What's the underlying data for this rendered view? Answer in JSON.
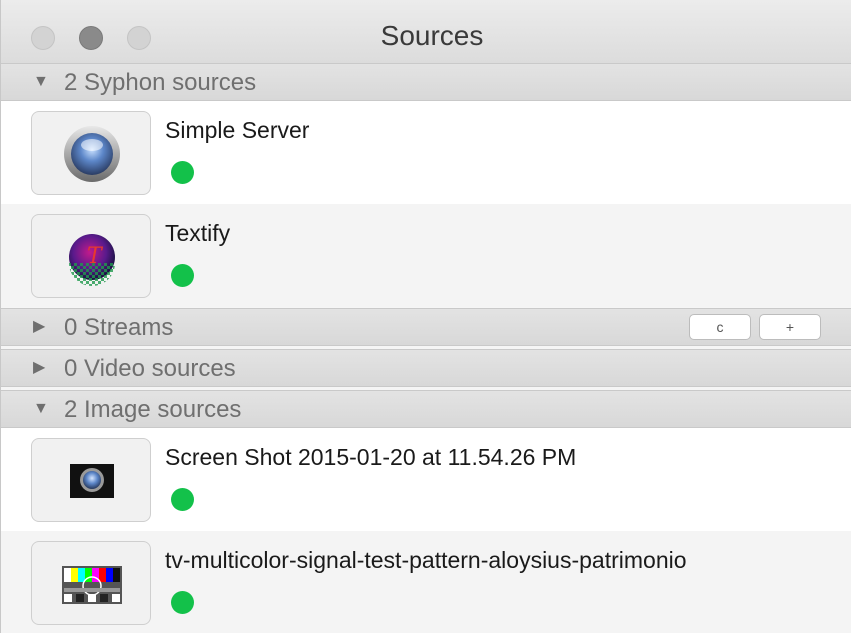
{
  "window": {
    "title": "Sources"
  },
  "sections": {
    "syphon": {
      "label": "2 Syphon sources",
      "expanded": true
    },
    "streams": {
      "label": "0 Streams",
      "expanded": false,
      "buttons": [
        "c",
        "+"
      ]
    },
    "video": {
      "label": "0 Video sources",
      "expanded": false
    },
    "image": {
      "label": "2 Image sources",
      "expanded": true
    }
  },
  "syphon_items": [
    {
      "name": "Simple Server",
      "status": "active",
      "status_color": "#13c14a",
      "icon": "simple-server-icon"
    },
    {
      "name": "Textify",
      "status": "active",
      "status_color": "#13c14a",
      "icon": "textify-icon"
    }
  ],
  "image_items": [
    {
      "name": "Screen Shot 2015-01-20 at 11.54.26 PM",
      "status": "active",
      "status_color": "#13c14a",
      "icon": "screenshot-thumbnail-icon"
    },
    {
      "name": "tv-multicolor-signal-test-pattern-aloysius-patrimonio",
      "status": "active",
      "status_color": "#13c14a",
      "icon": "test-pattern-thumbnail-icon"
    }
  ],
  "glyphs": {
    "expanded": "▼",
    "collapsed": "▶"
  }
}
